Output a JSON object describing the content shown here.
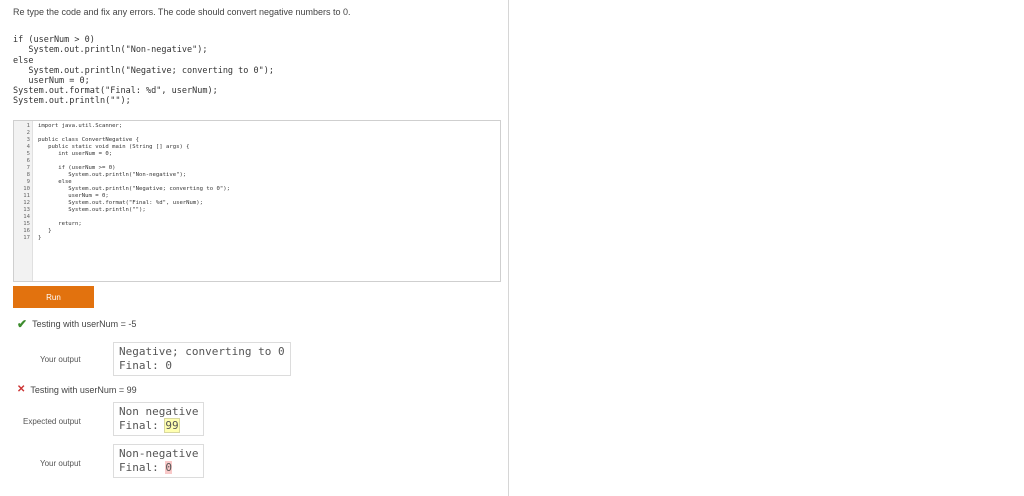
{
  "instructions": "Re type the code and fix any errors. The code should convert negative numbers to 0.",
  "snippet_lines": [
    "if (userNum > 0)",
    "   System.out.println(\"Non-negative\");",
    "else",
    "   System.out.println(\"Negative; converting to 0\");",
    "   userNum = 0;",
    "System.out.format(\"Final: %d\", userNum);",
    "System.out.println(\"\");"
  ],
  "editor": {
    "line_numbers": [
      "1",
      "2",
      "3",
      "4",
      "5",
      "6",
      "7",
      "8",
      "9",
      "10",
      "11",
      "12",
      "13",
      "14",
      "15",
      "16",
      "17"
    ],
    "lines": [
      "import java.util.Scanner;",
      "",
      "public class ConvertNegative {",
      "   public static void main (String [] args) {",
      "      int userNum = 0;",
      "",
      "      if (userNum >= 0)",
      "         System.out.println(\"Non-negative\");",
      "      else",
      "         System.out.println(\"Negative; converting to 0\");",
      "         userNum = 0;",
      "         System.out.format(\"Final: %d\", userNum);",
      "         System.out.println(\"\");",
      "",
      "      return;",
      "   }",
      "}"
    ]
  },
  "run_label": "Run",
  "test1": {
    "title": "Testing with userNum = -5",
    "your_output_label": "Your output",
    "your_output_lines": [
      "Negative; converting to 0",
      "Final: 0"
    ]
  },
  "test2": {
    "title": "Testing with userNum = 99",
    "expected_label": "Expected output",
    "expected_line1": "Non negative",
    "expected_prefix": "Final: ",
    "expected_value": "99",
    "your_output_label": "Your output",
    "your_line1": "Non-negative",
    "your_prefix": "Final: ",
    "your_value": "0"
  },
  "colors": {
    "run_button": "#e2720e",
    "pass": "#3d8c2e",
    "fail": "#cc3333"
  }
}
